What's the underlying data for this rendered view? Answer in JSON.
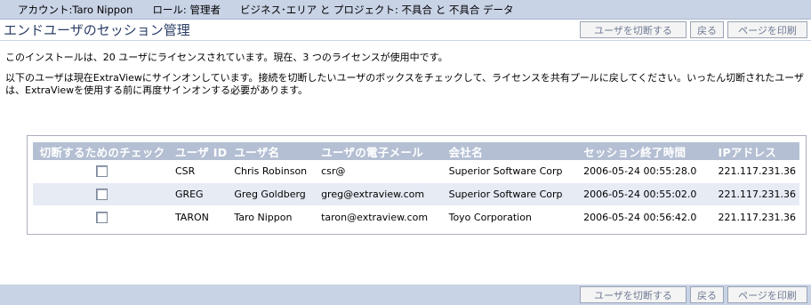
{
  "topbar": {
    "account": "アカウント:Taro Nippon",
    "role": "ロール: 管理者",
    "area": "ビジネス･エリア と プロジェクト: 不具合 と 不具合 データ"
  },
  "header": {
    "title": "エンドユーザのセッション管理",
    "disconnect_label": "ユーザを切断する",
    "back_label": "戻る",
    "print_label": "ページを印刷"
  },
  "info": {
    "license_text": "このインストールは、20 ユーザにライセンスされています。現在、3 つのライセンスが使用中です。",
    "instructions": "以下のユーザは現在ExtraViewにサインオンしています。接続を切断したいユーザのボックスをチェックして、ライセンスを共有プールに戻してください。いったん切断されたユーザは、ExtraViewを使用する前に再度サインオンする必要があります。"
  },
  "table": {
    "headers": [
      "切断するためのチェック",
      "ユーザ ID",
      "ユーザ名",
      "ユーザの電子メール",
      "会社名",
      "セッション終了時間",
      "IPアドレス"
    ],
    "rows": [
      {
        "user_id": "CSR",
        "user_name": "Chris Robinson",
        "email": "csr@",
        "company": "Superior Software Corp",
        "session_end": "2006-05-24 00:55:28.0",
        "ip": "221.117.231.36"
      },
      {
        "user_id": "GREG",
        "user_name": "Greg Goldberg",
        "email": "greg@extraview.com",
        "company": "Superior Software Corp",
        "session_end": "2006-05-24 00:55:02.0",
        "ip": "221.117.231.36"
      },
      {
        "user_id": "TARON",
        "user_name": "Taro Nippon",
        "email": "taron@extraview.com",
        "company": "Toyo Corporation",
        "session_end": "2006-05-24 00:56:42.0",
        "ip": "221.117.231.36"
      }
    ]
  },
  "footer": {
    "disconnect_label": "ユーザを切断する",
    "back_label": "戻る",
    "print_label": "ページを印刷"
  }
}
